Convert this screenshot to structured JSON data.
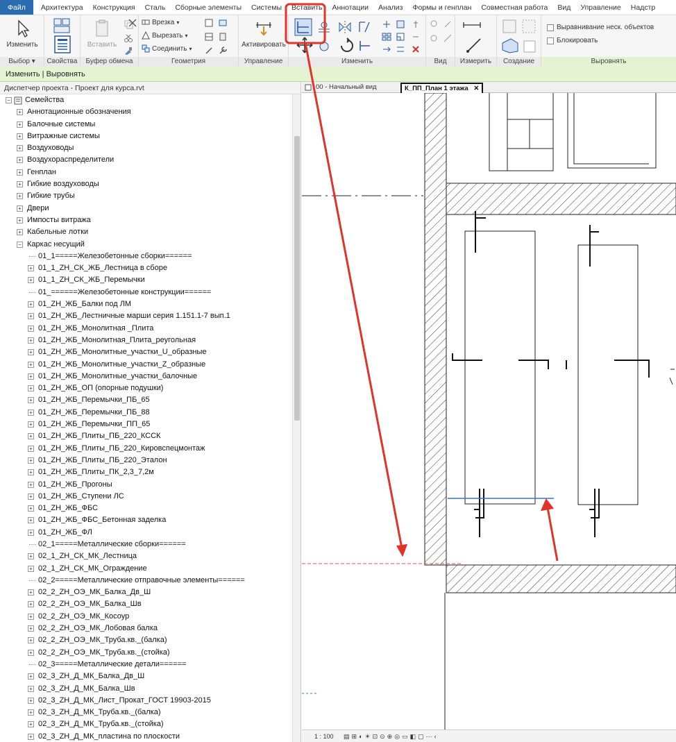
{
  "menu": {
    "tabs": [
      "Файл",
      "Архитектура",
      "Конструкция",
      "Сталь",
      "Сборные элементы",
      "Системы",
      "Вставить",
      "Аннотации",
      "Анализ",
      "Формы и генплан",
      "Совместная работа",
      "Вид",
      "Управление",
      "Надстр"
    ]
  },
  "ribbon": {
    "select": {
      "modify_label": "Изменить",
      "group": "Выбор"
    },
    "properties": {
      "group": "Свойства"
    },
    "clipboard": {
      "paste_label": "Вставить",
      "group": "Буфер обмена"
    },
    "geometry": {
      "cope": "Врезка",
      "cut": "Вырезать",
      "join": "Соединить",
      "group": "Геометрия"
    },
    "control": {
      "activate_label": "Активировать",
      "group": "Управление"
    },
    "modify": {
      "group": "Изменить"
    },
    "view": {
      "group": "Вид"
    },
    "measure": {
      "group": "Измерить"
    },
    "create": {
      "group": "Создание"
    },
    "align": {
      "option1": "Выравнивание неск. объектов",
      "option2": "Блокировать",
      "group": "Выровнять"
    }
  },
  "context": {
    "label": "Изменить | Выровнять"
  },
  "browser": {
    "title": "Диспетчер проекта - Проект для курса.rvt",
    "root": "Семейства",
    "items": [
      {
        "level": 1,
        "expander": "+",
        "text": "Аннотационные обозначения"
      },
      {
        "level": 1,
        "expander": "+",
        "text": "Балочные системы"
      },
      {
        "level": 1,
        "expander": "+",
        "text": "Витражные системы"
      },
      {
        "level": 1,
        "expander": "+",
        "text": "Воздуховоды"
      },
      {
        "level": 1,
        "expander": "+",
        "text": "Воздухораспределители"
      },
      {
        "level": 1,
        "expander": "+",
        "text": "Генплан"
      },
      {
        "level": 1,
        "expander": "+",
        "text": "Гибкие воздуховоды"
      },
      {
        "level": 1,
        "expander": "+",
        "text": "Гибкие трубы"
      },
      {
        "level": 1,
        "expander": "+",
        "text": "Двери"
      },
      {
        "level": 1,
        "expander": "+",
        "text": "Импосты витража"
      },
      {
        "level": 1,
        "expander": "+",
        "text": "Кабельные лотки"
      },
      {
        "level": 1,
        "expander": "-",
        "text": "Каркас несущий"
      },
      {
        "level": 2,
        "expander": "",
        "text": "01_1=====Железобетонные сборки======"
      },
      {
        "level": 2,
        "expander": "+",
        "text": "01_1_ZH_СК_ЖБ_Лестница в сборе"
      },
      {
        "level": 2,
        "expander": "+",
        "text": "01_1_ZH_СК_ЖБ_Перемычки"
      },
      {
        "level": 2,
        "expander": "",
        "text": "01_======Железобетонные конструкции======"
      },
      {
        "level": 2,
        "expander": "+",
        "text": "01_ZH_ЖБ_Балки под ЛМ"
      },
      {
        "level": 2,
        "expander": "+",
        "text": "01_ZH_ЖБ_Лестничные марши серия 1.151.1-7 вып.1"
      },
      {
        "level": 2,
        "expander": "+",
        "text": "01_ZH_ЖБ_Монолитная _Плита"
      },
      {
        "level": 2,
        "expander": "+",
        "text": "01_ZH_ЖБ_Монолитная_Плита_реугольная"
      },
      {
        "level": 2,
        "expander": "+",
        "text": "01_ZH_ЖБ_Монолитные_участки_U_образные"
      },
      {
        "level": 2,
        "expander": "+",
        "text": "01_ZH_ЖБ_Монолитные_участки_Z_образные"
      },
      {
        "level": 2,
        "expander": "+",
        "text": "01_ZH_ЖБ_Монолитные_участки_балочные"
      },
      {
        "level": 2,
        "expander": "+",
        "text": "01_ZH_ЖБ_ОП (опорные подушки)"
      },
      {
        "level": 2,
        "expander": "+",
        "text": "01_ZH_ЖБ_Перемычки_ПБ_65"
      },
      {
        "level": 2,
        "expander": "+",
        "text": "01_ZH_ЖБ_Перемычки_ПБ_88"
      },
      {
        "level": 2,
        "expander": "+",
        "text": "01_ZH_ЖБ_Перемычки_ПП_65"
      },
      {
        "level": 2,
        "expander": "+",
        "text": "01_ZH_ЖБ_Плиты_ПБ_220_КССК"
      },
      {
        "level": 2,
        "expander": "+",
        "text": "01_ZH_ЖБ_Плиты_ПБ_220_Кировспецмонтаж"
      },
      {
        "level": 2,
        "expander": "+",
        "text": "01_ZH_ЖБ_Плиты_ПБ_220_Эталон"
      },
      {
        "level": 2,
        "expander": "+",
        "text": "01_ZH_ЖБ_Плиты_ПК_2,3_7,2м"
      },
      {
        "level": 2,
        "expander": "+",
        "text": "01_ZH_ЖБ_Прогоны"
      },
      {
        "level": 2,
        "expander": "+",
        "text": "01_ZH_ЖБ_Ступени ЛС"
      },
      {
        "level": 2,
        "expander": "+",
        "text": "01_ZH_ЖБ_ФБС"
      },
      {
        "level": 2,
        "expander": "+",
        "text": "01_ZH_ЖБ_ФБС_Бетонная заделка"
      },
      {
        "level": 2,
        "expander": "+",
        "text": "01_ZH_ЖБ_ФЛ"
      },
      {
        "level": 2,
        "expander": "",
        "text": "02_1=====Металлические сборки======"
      },
      {
        "level": 2,
        "expander": "+",
        "text": "02_1_ZH_СК_МК_Лестница"
      },
      {
        "level": 2,
        "expander": "+",
        "text": "02_1_ZH_СК_МК_Ограждение"
      },
      {
        "level": 2,
        "expander": "",
        "text": "02_2=====Металлические отправочные элементы======"
      },
      {
        "level": 2,
        "expander": "+",
        "text": "02_2_ZH_ОЭ_МК_Балка_Дв_Ш"
      },
      {
        "level": 2,
        "expander": "+",
        "text": "02_2_ZH_ОЭ_МК_Балка_Шв"
      },
      {
        "level": 2,
        "expander": "+",
        "text": "02_2_ZH_ОЭ_МК_Косоур"
      },
      {
        "level": 2,
        "expander": "+",
        "text": "02_2_ZH_ОЭ_МК_Лобовая балка"
      },
      {
        "level": 2,
        "expander": "+",
        "text": "02_2_ZH_ОЭ_МК_Труба.кв._(балка)"
      },
      {
        "level": 2,
        "expander": "+",
        "text": "02_2_ZH_ОЭ_МК_Труба.кв._(стойка)"
      },
      {
        "level": 2,
        "expander": "",
        "text": "02_3=====Металлические детали======"
      },
      {
        "level": 2,
        "expander": "+",
        "text": "02_3_ZH_Д_МК_Балка_Дв_Ш"
      },
      {
        "level": 2,
        "expander": "+",
        "text": "02_3_ZH_Д_МК_Балка_Шв"
      },
      {
        "level": 2,
        "expander": "+",
        "text": "02_3_ZH_Д_МК_Лист_Прокат_ГОСТ 19903-2015"
      },
      {
        "level": 2,
        "expander": "+",
        "text": "02_3_ZH_Д_МК_Труба.кв._(балка)"
      },
      {
        "level": 2,
        "expander": "+",
        "text": "02_3_ZH_Д_МК_Труба.кв._(стойка)"
      },
      {
        "level": 2,
        "expander": "+",
        "text": "02_3_ZH_Д_МК_пластина по плоскости"
      }
    ]
  },
  "view_tabs": {
    "tab1": "00 - Начальный вид",
    "tab2": "К_ПП_План 1 этажа"
  },
  "status": {
    "scale": "1 : 100"
  },
  "colors": {
    "file_tab": "#2b6cb0",
    "context_bar": "#e5f3d3",
    "annotation_red": "#e0342a",
    "align_line": "#3a6fd8"
  },
  "icons": [
    "modify-arrow-icon",
    "properties-icon",
    "paste-icon",
    "cope-icon",
    "cut-icon",
    "join-icon",
    "activate-icon",
    "align-icon",
    "offset-icon",
    "mirror-icon",
    "move-icon",
    "rotate-icon",
    "measure-icon",
    "create-icon"
  ]
}
